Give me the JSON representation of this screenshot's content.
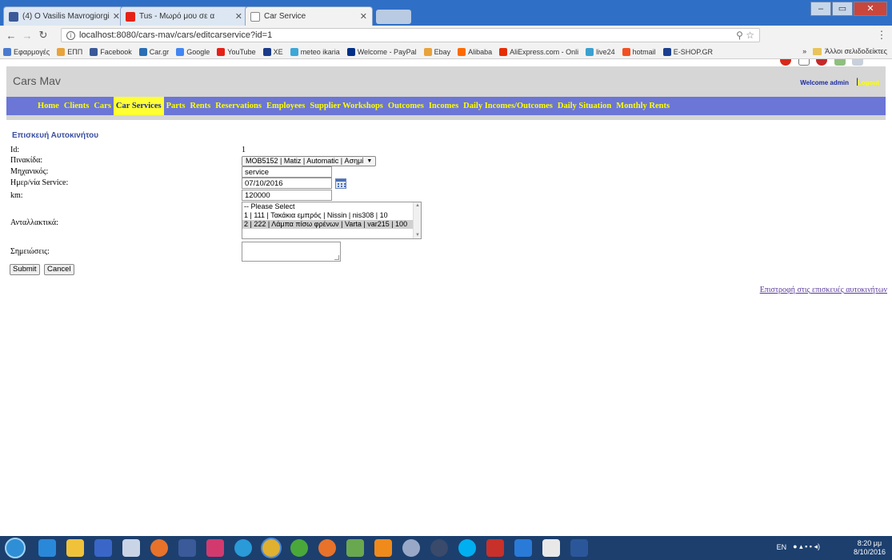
{
  "browser": {
    "tabs": [
      {
        "title": "(4) O Vasilis Mavrogiorgi",
        "icon": "facebook-icon",
        "color": "#3b5998",
        "active": false
      },
      {
        "title": "Tus - Μωρό μου σε α",
        "icon": "youtube-icon",
        "color": "#e62117",
        "active": false
      },
      {
        "title": "Car Service",
        "icon": "page-icon",
        "color": "#8a8a8a",
        "active": true
      }
    ],
    "url": "localhost:8080/cars-mav/cars/editcarservice?id=1",
    "bookmarks": [
      {
        "label": "Εφαρμογές",
        "color": "#4a7bd0"
      },
      {
        "label": "ΕΠΠ",
        "color": "#e8a33a"
      },
      {
        "label": "Facebook",
        "color": "#3b5998"
      },
      {
        "label": "Car.gr",
        "color": "#2a6db5"
      },
      {
        "label": "Google",
        "color": "#4285f4"
      },
      {
        "label": "YouTube",
        "color": "#e62117"
      },
      {
        "label": "XE",
        "color": "#1a3a8a"
      },
      {
        "label": "meteo ikaria",
        "color": "#3da7d8"
      },
      {
        "label": "Welcome - PayPal",
        "color": "#003087"
      },
      {
        "label": "Ebay",
        "color": "#e8a33a"
      },
      {
        "label": "Alibaba",
        "color": "#ff6a00"
      },
      {
        "label": "AliExpress.com - Onli",
        "color": "#e62e04"
      },
      {
        "label": "live24",
        "color": "#3aa0d0"
      },
      {
        "label": "hotmail",
        "color": "#f25022"
      },
      {
        "label": "E-SHOP.GR",
        "color": "#1b3f8f"
      }
    ],
    "bookmarks_more": "»",
    "other_bookmarks": "Άλλοι σελιδοδείκτες"
  },
  "site": {
    "title": "Cars Mav",
    "welcome": "Welcome admin",
    "separator": "|",
    "logout": "Logout"
  },
  "menu": [
    {
      "label": "Home",
      "active": false
    },
    {
      "label": "Clients",
      "active": false
    },
    {
      "label": "Cars",
      "active": false
    },
    {
      "label": "Car Services",
      "active": true
    },
    {
      "label": "Parts",
      "active": false
    },
    {
      "label": "Rents",
      "active": false
    },
    {
      "label": "Reservations",
      "active": false
    },
    {
      "label": "Employees",
      "active": false
    },
    {
      "label": "Supplier Workshops",
      "active": false
    },
    {
      "label": "Outcomes",
      "active": false
    },
    {
      "label": "Incomes",
      "active": false
    },
    {
      "label": "Daily Incomes/Outcomes",
      "active": false
    },
    {
      "label": "Daily Situation",
      "active": false
    },
    {
      "label": "Monthly Rents",
      "active": false
    }
  ],
  "form": {
    "title": "Επισκευή Αυτοκινήτου",
    "id_label": "Id:",
    "id_value": "1",
    "plate_label": "Πινακίδα:",
    "plate_value": "MOB5152 | Matiz | Automatic | Ασημί",
    "mechanic_label": "Μηχανικός:",
    "mechanic_value": "service",
    "date_label": "Ημερ/νία Service:",
    "date_value": "07/10/2016",
    "km_label": "km:",
    "km_value": "120000",
    "parts_label": "Ανταλλακτικά:",
    "parts_options": [
      {
        "label": "-- Please Select",
        "selected": false
      },
      {
        "label": "1 | 111 | Τακάκια εμπρός | Nissin | nis308 | 10",
        "selected": false
      },
      {
        "label": "2 | 222 | Λάμπα πίσω φρένων | Varta | var215 | 100",
        "selected": true
      }
    ],
    "notes_label": "Σημειώσεις:",
    "notes_value": "",
    "submit_label": "Submit",
    "cancel_label": "Cancel"
  },
  "back_link": "Επιστροφή στις επισκευές αυτοκινήτων",
  "taskbar": {
    "language": "EN",
    "time": "8:20 μμ",
    "date": "8/10/2016",
    "icons": [
      {
        "name": "chrome-remote-icon",
        "color": "#2a88d8"
      },
      {
        "name": "file-explorer-icon",
        "color": "#f0c23a"
      },
      {
        "name": "media-player-icon",
        "color": "#3a66c8"
      },
      {
        "name": "paint-icon",
        "color": "#c9d4e6"
      },
      {
        "name": "eject-icon",
        "color": "#e8722a"
      },
      {
        "name": "network-icon",
        "color": "#3a5a9a"
      },
      {
        "name": "fs-icon",
        "color": "#d23a6e"
      },
      {
        "name": "internet-explorer-icon",
        "color": "#2a9ad8"
      },
      {
        "name": "chrome-icon",
        "color": "#e0b030"
      },
      {
        "name": "utorrent-icon",
        "color": "#4aa83a"
      },
      {
        "name": "firefox-icon",
        "color": "#e8722a"
      },
      {
        "name": "tools-icon",
        "color": "#6aa84f"
      },
      {
        "name": "vlc-icon",
        "color": "#f08a1a"
      },
      {
        "name": "media-icon",
        "color": "#9aa8c8"
      },
      {
        "name": "steam-icon",
        "color": "#3a4a6a"
      },
      {
        "name": "skype-icon",
        "color": "#00aff0"
      },
      {
        "name": "filezilla-icon",
        "color": "#c8302a"
      },
      {
        "name": "dropbox-icon",
        "color": "#2a7ad8"
      },
      {
        "name": "java-icon",
        "color": "#e8e8e8"
      },
      {
        "name": "word-icon",
        "color": "#2b579a"
      }
    ]
  }
}
